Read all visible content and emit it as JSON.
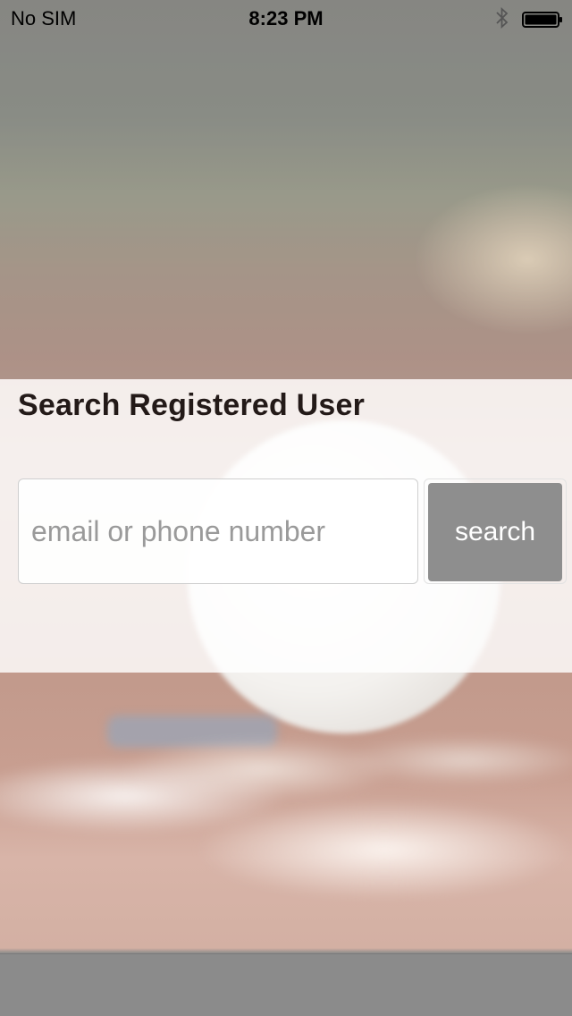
{
  "status_bar": {
    "carrier": "No SIM",
    "time": "8:23 PM",
    "bluetooth_icon": "bluetooth-icon",
    "battery_icon": "battery-icon"
  },
  "search": {
    "title": "Search Registered User",
    "input_placeholder": "email or phone number",
    "input_value": "",
    "button_label": "search"
  },
  "colors": {
    "button_bg": "#8e8e8e",
    "panel_bg": "#ffffff",
    "title_text": "#231a18"
  }
}
